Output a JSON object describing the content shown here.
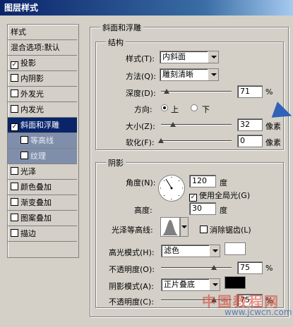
{
  "window": {
    "title": "图层样式"
  },
  "styles_panel": {
    "header": "样式",
    "items": [
      {
        "label": "混合选项:默认",
        "checkbox": false
      },
      {
        "label": "投影",
        "checkbox": true,
        "checked": true
      },
      {
        "label": "内阴影",
        "checkbox": true,
        "checked": false
      },
      {
        "label": "外发光",
        "checkbox": true,
        "checked": false
      },
      {
        "label": "内发光",
        "checkbox": true,
        "checked": false
      },
      {
        "label": "斜面和浮雕",
        "checkbox": true,
        "checked": true,
        "selected": true
      },
      {
        "label": "等高线",
        "checkbox": true,
        "checked": false,
        "sub": true
      },
      {
        "label": "纹理",
        "checkbox": true,
        "checked": false,
        "sub": true
      },
      {
        "label": "光泽",
        "checkbox": true,
        "checked": false
      },
      {
        "label": "颜色叠加",
        "checkbox": true,
        "checked": false
      },
      {
        "label": "渐变叠加",
        "checkbox": true,
        "checked": false
      },
      {
        "label": "图案叠加",
        "checkbox": true,
        "checked": false
      },
      {
        "label": "描边",
        "checkbox": true,
        "checked": false
      }
    ]
  },
  "bevel": {
    "title": "斜面和浮雕",
    "structure": {
      "title": "结构",
      "style_label": "样式(T):",
      "style_value": "内斜面",
      "technique_label": "方法(Q):",
      "technique_value": "雕刻清晰",
      "depth_label": "深度(D):",
      "depth_value": "71",
      "depth_unit": "%",
      "depth_level": 0.08,
      "direction_label": "方向:",
      "dir_up": "上",
      "dir_down": "下",
      "direction": "up",
      "size_label": "大小(Z):",
      "size_value": "32",
      "size_unit": "像素",
      "size_level": 0.17,
      "soften_label": "软化(F):",
      "soften_value": "0",
      "soften_unit": "像素",
      "soften_level": 0.0
    },
    "shading": {
      "title": "阴影",
      "angle_label": "角度(N):",
      "angle_value": "120",
      "angle_unit": "度",
      "global_light_label": "使用全局光(G)",
      "global_light": true,
      "altitude_label": "高度:",
      "altitude_value": "30",
      "altitude_unit": "度",
      "gloss_contour_label": "光泽等高线:",
      "antialias_label": "消除锯齿(L)",
      "antialias": false,
      "highlight_mode_label": "高光模式(H):",
      "highlight_mode": "滤色",
      "highlight_color": "#ffffff",
      "highlight_opacity_label": "不透明度(O):",
      "highlight_opacity": "75",
      "highlight_opacity_unit": "%",
      "highlight_level": 0.75,
      "shadow_mode_label": "阴影模式(A):",
      "shadow_mode": "正片叠底",
      "shadow_color": "#000000",
      "shadow_opacity_label": "不透明度(C):",
      "shadow_opacity": "75",
      "shadow_opacity_unit": "%",
      "shadow_level": 0.75
    }
  },
  "watermark": {
    "main": "中国教程网",
    "url": "www.jcwcn.com"
  }
}
